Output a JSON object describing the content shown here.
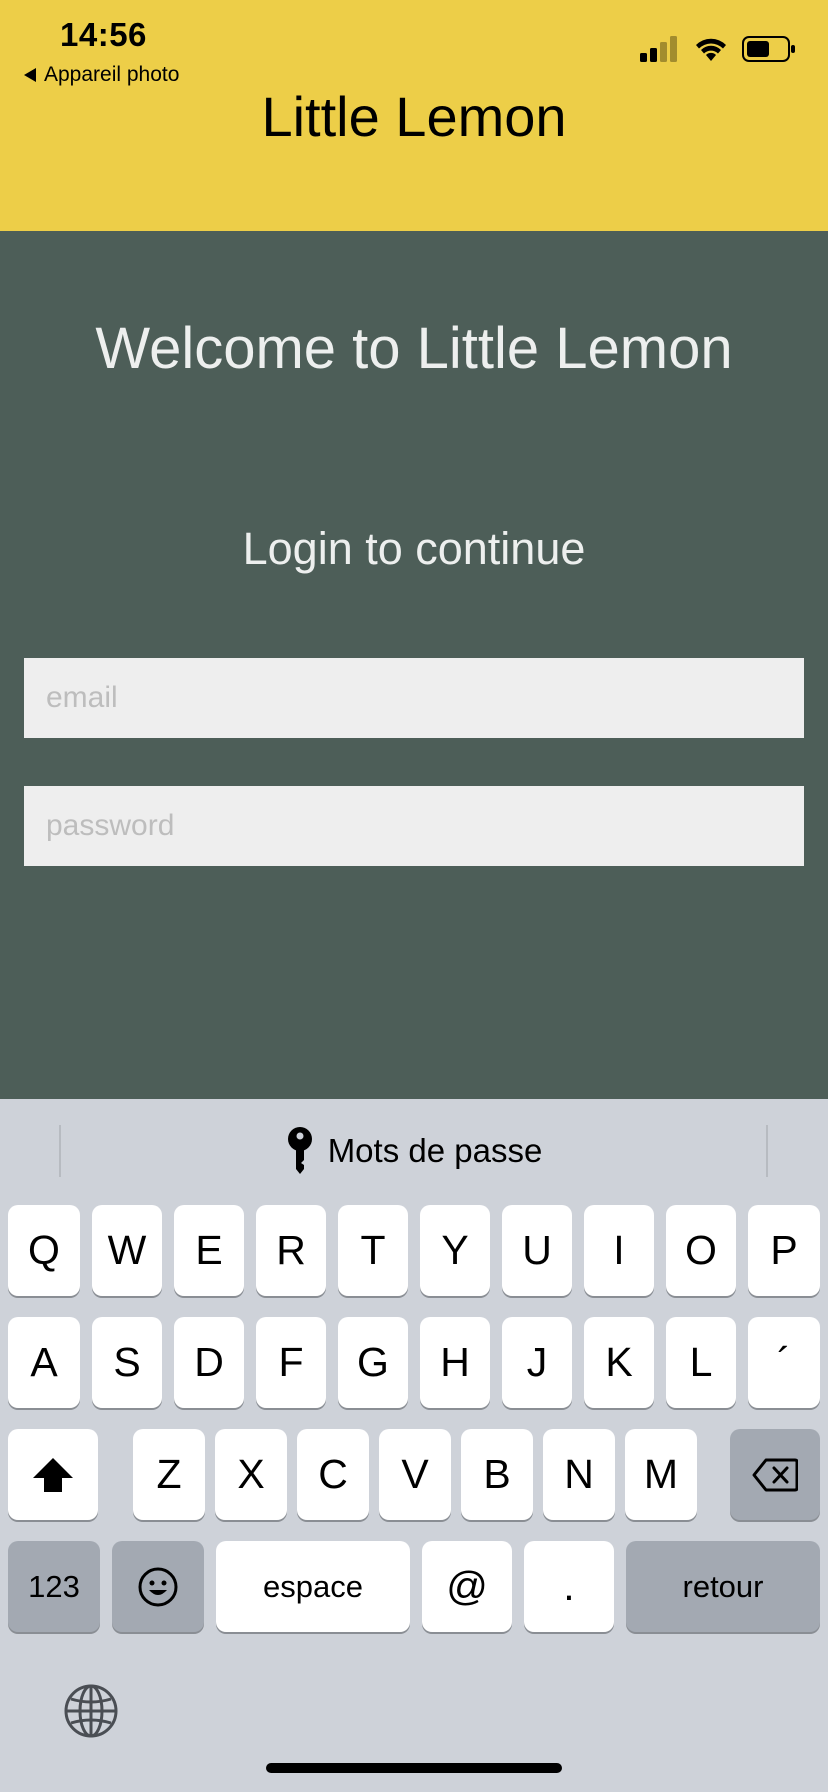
{
  "status_bar": {
    "time": "14:56",
    "back_label": "Appareil photo"
  },
  "header": {
    "title": "Little Lemon",
    "bg_color": "#EDCE48"
  },
  "main": {
    "welcome": "Welcome to Little Lemon",
    "subtitle": "Login to continue",
    "email_placeholder": "email",
    "password_placeholder": "password",
    "bg_color": "#4D5E58"
  },
  "keyboard": {
    "suggestion": "Mots de passe",
    "row1": [
      "Q",
      "W",
      "E",
      "R",
      "T",
      "Y",
      "U",
      "I",
      "O",
      "P"
    ],
    "row2": [
      "A",
      "S",
      "D",
      "F",
      "G",
      "H",
      "J",
      "K",
      "L",
      "´"
    ],
    "row3": [
      "Z",
      "X",
      "C",
      "V",
      "B",
      "N",
      "M"
    ],
    "numbers_label": "123",
    "space_label": "espace",
    "at_label": "@",
    "dot_label": ".",
    "return_label": "retour"
  }
}
